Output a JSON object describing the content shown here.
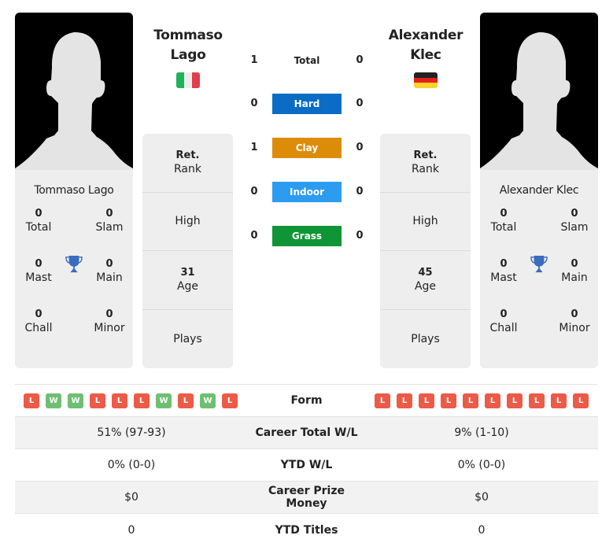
{
  "colors": {
    "hard": "#0a6cc4",
    "clay": "#dd8c0a",
    "indoor": "#2c9cf0",
    "grass": "#0f9535",
    "win": "#6fbf73",
    "loss": "#ec5b48",
    "trophy": "#3a6cbf"
  },
  "player1": {
    "name_line1": "Tommaso",
    "name_line2": "Lago",
    "full_name": "Tommaso Lago",
    "flag": "italy-flag",
    "titles": {
      "total": "0",
      "total_label": "Total",
      "slam": "0",
      "slam_label": "Slam",
      "mast": "0",
      "mast_label": "Mast",
      "main": "0",
      "main_label": "Main",
      "chall": "0",
      "chall_label": "Chall",
      "minor": "0",
      "minor_label": "Minor"
    },
    "info": {
      "rank_value": "Ret.",
      "rank_label": "Rank",
      "high_label": "High",
      "age_value": "31",
      "age_label": "Age",
      "plays_label": "Plays"
    },
    "form": [
      "L",
      "W",
      "W",
      "L",
      "L",
      "L",
      "W",
      "L",
      "W",
      "L"
    ],
    "career_wl": "51% (97-93)",
    "ytd_wl": "0% (0-0)",
    "prize": "$0",
    "ytd_titles": "0"
  },
  "player2": {
    "name_line1": "Alexander",
    "name_line2": "Klec",
    "full_name": "Alexander Klec",
    "flag": "germany-flag",
    "titles": {
      "total": "0",
      "total_label": "Total",
      "slam": "0",
      "slam_label": "Slam",
      "mast": "0",
      "mast_label": "Mast",
      "main": "0",
      "main_label": "Main",
      "chall": "0",
      "chall_label": "Chall",
      "minor": "0",
      "minor_label": "Minor"
    },
    "info": {
      "rank_value": "Ret.",
      "rank_label": "Rank",
      "high_label": "High",
      "age_value": "45",
      "age_label": "Age",
      "plays_label": "Plays"
    },
    "form": [
      "L",
      "L",
      "L",
      "L",
      "L",
      "L",
      "L",
      "L",
      "L",
      "L"
    ],
    "career_wl": "9% (1-10)",
    "ytd_wl": "0% (0-0)",
    "prize": "$0",
    "ytd_titles": "0"
  },
  "h2h": [
    {
      "label": "Total",
      "p1": "1",
      "p2": "0",
      "surface": "total"
    },
    {
      "label": "Hard",
      "p1": "0",
      "p2": "0",
      "surface": "hard"
    },
    {
      "label": "Clay",
      "p1": "1",
      "p2": "0",
      "surface": "clay"
    },
    {
      "label": "Indoor",
      "p1": "0",
      "p2": "0",
      "surface": "indoor"
    },
    {
      "label": "Grass",
      "p1": "0",
      "p2": "0",
      "surface": "grass"
    }
  ],
  "table_labels": {
    "form": "Form",
    "career_wl": "Career Total W/L",
    "ytd_wl": "YTD W/L",
    "prize": "Career Prize Money",
    "ytd_titles": "YTD Titles"
  }
}
